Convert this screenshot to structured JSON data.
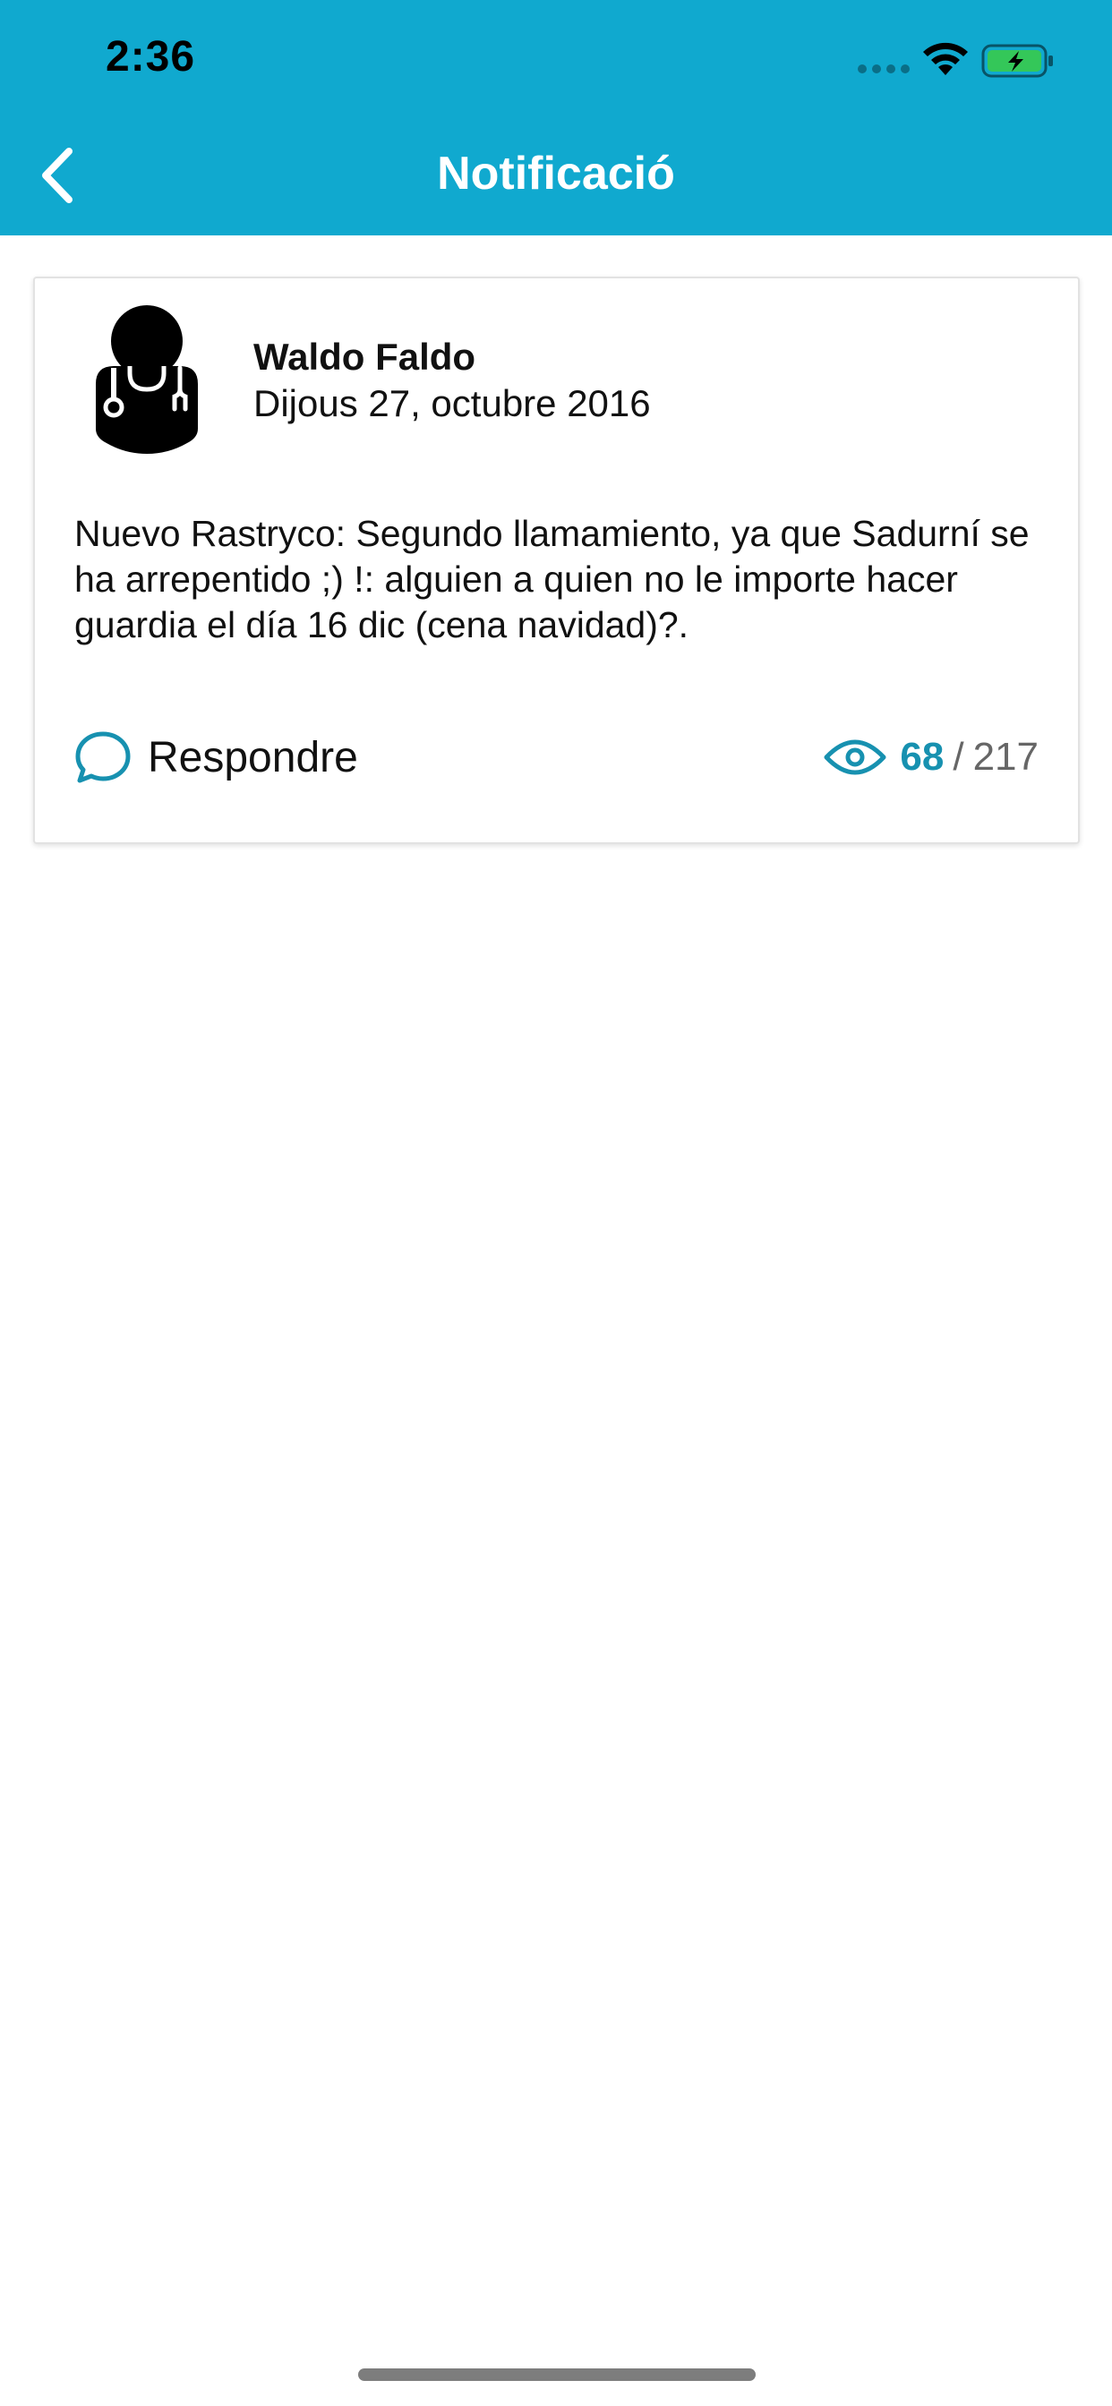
{
  "status_bar": {
    "time": "2:36"
  },
  "header": {
    "title": "Notificació"
  },
  "notification": {
    "author": "Waldo Faldo",
    "date": "Dijous 27, octubre 2016",
    "message": "Nuevo Rastryco: Segundo llamamiento, ya que Sadurní se ha arrepentido ;) !: alguien a quien no le importe hacer guardia el día 16 dic (cena navidad)?.",
    "reply_label": "Respondre",
    "views_read": "68",
    "views_separator": "/",
    "views_total": "217"
  },
  "icons": {
    "back": "chevron-left-icon",
    "avatar": "doctor-icon",
    "reply": "speech-bubble-icon",
    "views": "eye-icon"
  },
  "colors": {
    "header_bg": "#10a9cf",
    "accent": "#1791b0",
    "battery_fill": "#34c759"
  }
}
